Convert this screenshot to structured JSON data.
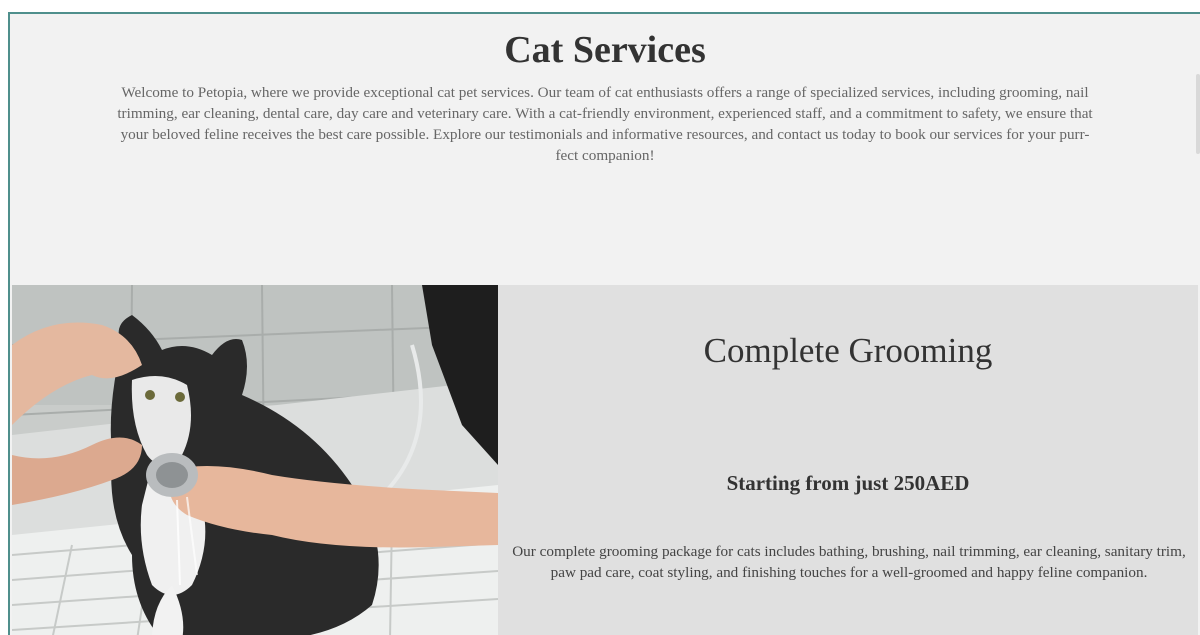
{
  "header": {
    "title": "Cat Services",
    "intro": "Welcome to Petopia, where we provide exceptional cat pet services. Our team of cat enthusiasts offers a range of specialized services, including grooming, nail trimming, ear cleaning, dental care, day care and veterinary care. With a cat-friendly environment, experienced staff, and a commitment to safety, we ensure that your beloved feline receives the best care possible. Explore our testimonials and informative resources, and contact us today to book our services for your purr-fect companion!"
  },
  "services": [
    {
      "title": "Complete Grooming",
      "price": "Starting from just 250AED",
      "description": "Our complete grooming package for cats includes bathing, brushing, nail trimming, ear cleaning, sanitary trim, paw pad care, coat styling, and finishing touches for a well-groomed and happy feline companion.",
      "image_icon": "cat-bath-photo"
    }
  ],
  "colors": {
    "page_background": "#f2f2f2",
    "panel_background": "#e0e0e0",
    "frame_border": "#4f8f8c",
    "heading_text": "#333333",
    "body_text": "#666666"
  }
}
